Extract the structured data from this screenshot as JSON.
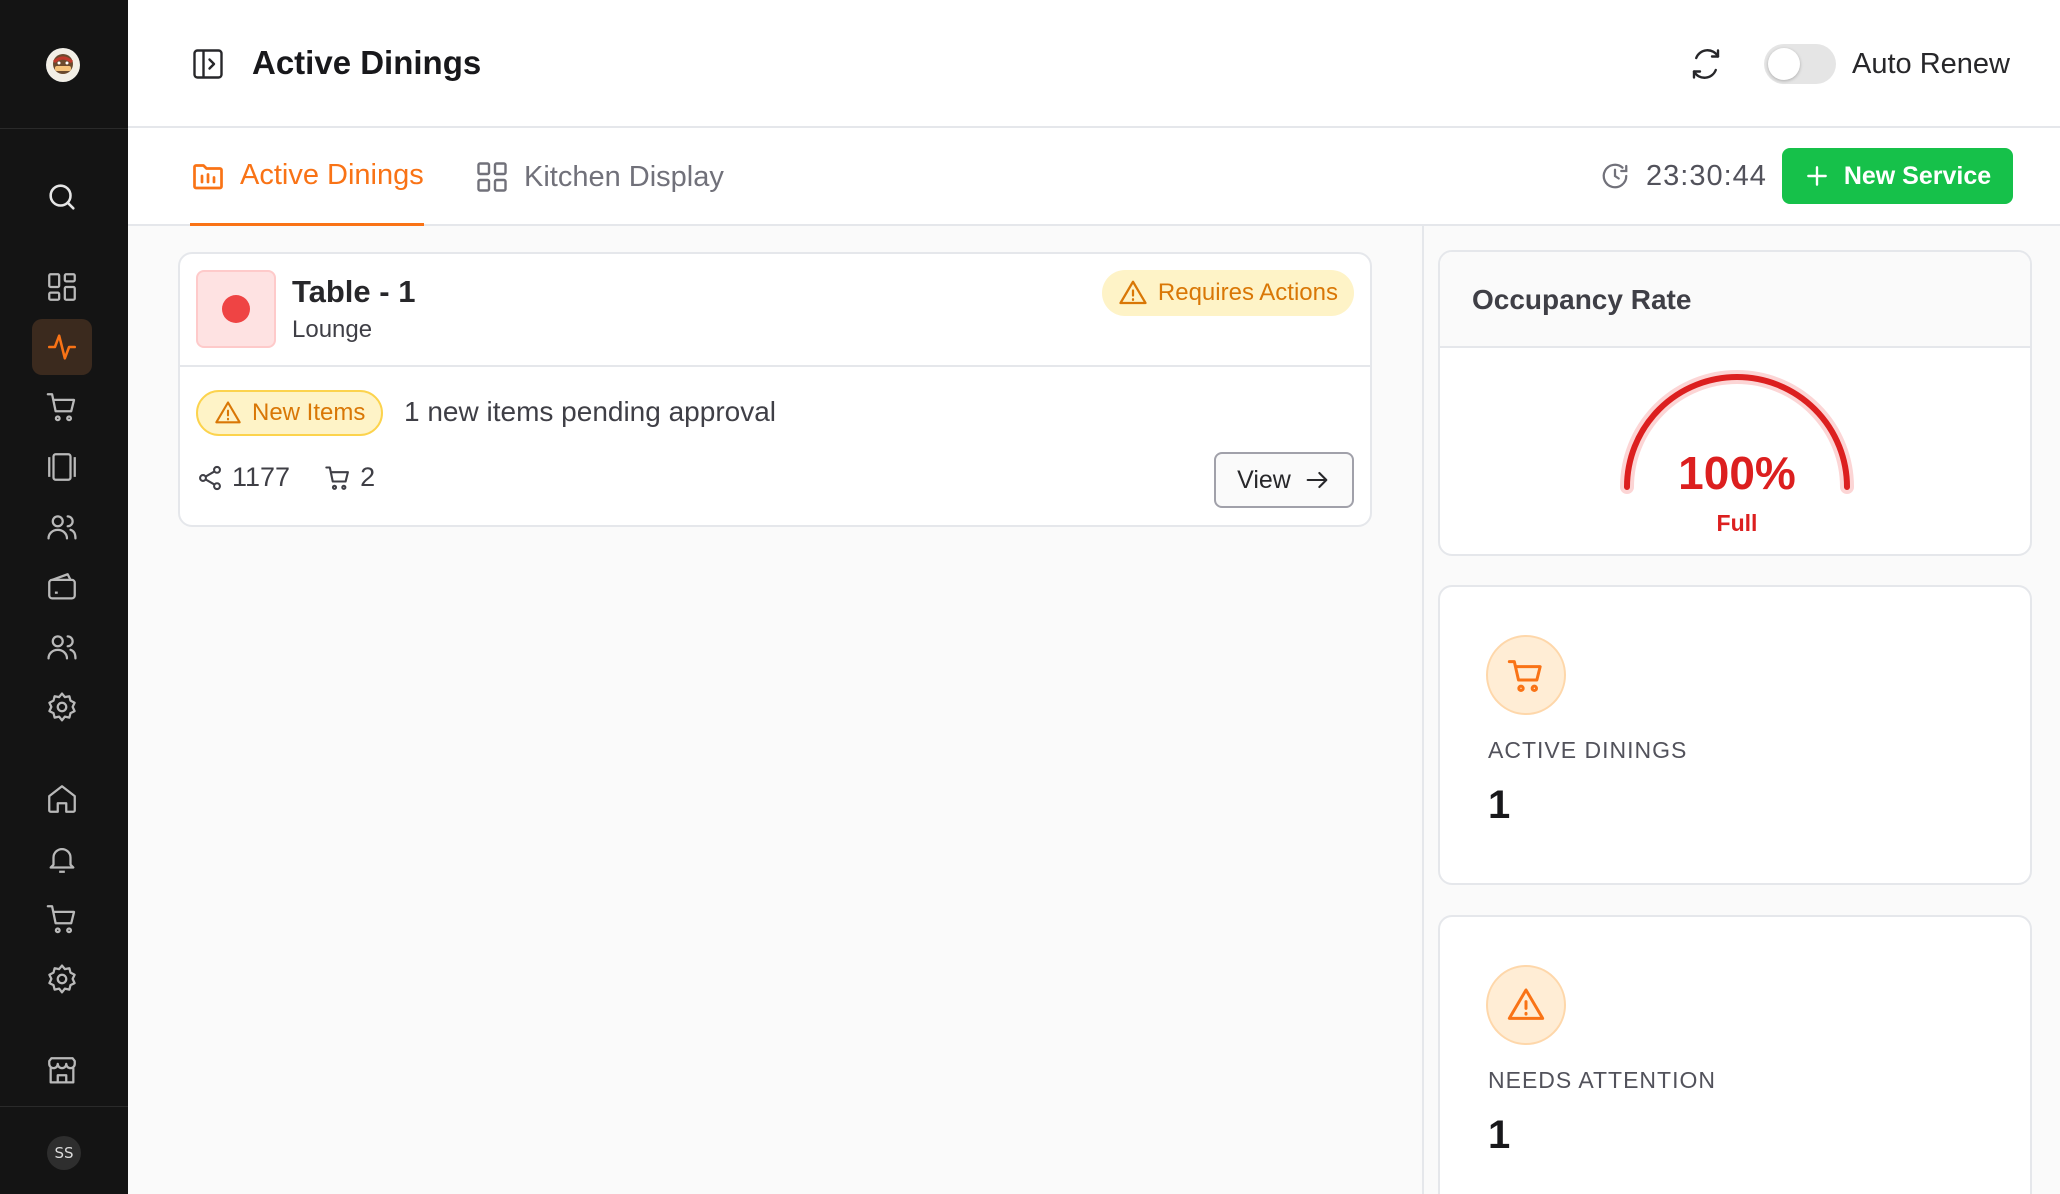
{
  "app": {
    "title": "Active Dinings"
  },
  "sidebar": {
    "avatar_initials": "SS",
    "items": [
      {
        "icon": "search-icon"
      },
      {
        "icon": "grid-icon"
      },
      {
        "icon": "activity-icon",
        "active": true
      },
      {
        "icon": "cart-icon"
      },
      {
        "icon": "gallery-icon"
      },
      {
        "icon": "users-icon"
      },
      {
        "icon": "wallet-icon"
      },
      {
        "icon": "team-icon"
      },
      {
        "icon": "gear-icon"
      },
      {
        "icon": "home-icon"
      },
      {
        "icon": "bell-icon"
      },
      {
        "icon": "cart-icon"
      },
      {
        "icon": "gear-icon"
      },
      {
        "icon": "store-icon"
      }
    ]
  },
  "header": {
    "title": "Active Dinings",
    "auto_renew_label": "Auto Renew",
    "auto_renew_on": false
  },
  "tabs": [
    {
      "label": "Active Dinings",
      "active": true
    },
    {
      "label": "Kitchen Display",
      "active": false
    }
  ],
  "toolbar": {
    "clock": "23:30:44",
    "new_service_label": "New Service"
  },
  "dinings": [
    {
      "table": "Table - 1",
      "area": "Lounge",
      "status_badge": "Requires Actions",
      "new_items_badge": "New Items",
      "pending_text": "1 new items pending approval",
      "share_count": "1177",
      "cart_count": "2",
      "view_label": "View"
    }
  ],
  "occupancy": {
    "title": "Occupancy Rate",
    "value_text": "100%",
    "fraction": 1.0,
    "status": "Full"
  },
  "stats": [
    {
      "label": "ACTIVE DININGS",
      "value": "1",
      "icon": "cart-icon"
    },
    {
      "label": "NEEDS ATTENTION",
      "value": "1",
      "icon": "warning-icon"
    }
  ],
  "colors": {
    "accent": "#f97316",
    "success": "#16c14a",
    "danger": "#dc1f1f",
    "warning": "#d97706",
    "sidebar_bg": "#141414"
  }
}
